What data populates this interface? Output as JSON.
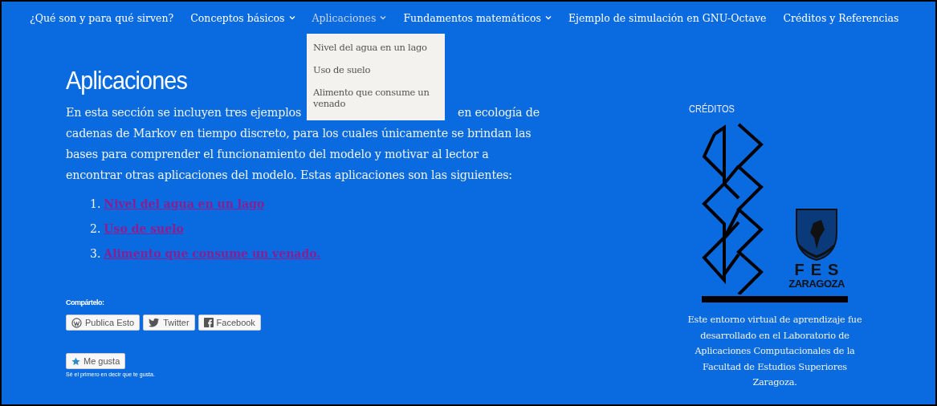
{
  "nav": {
    "items": [
      {
        "label": "¿Qué son y para qué sirven?",
        "has_submenu": false,
        "selected": false
      },
      {
        "label": "Conceptos básicos",
        "has_submenu": true,
        "selected": false
      },
      {
        "label": "Aplicaciones",
        "has_submenu": true,
        "selected": true
      },
      {
        "label": "Fundamentos matemáticos",
        "has_submenu": true,
        "selected": false
      },
      {
        "label": "Ejemplo de simulación en GNU-Octave",
        "has_submenu": false,
        "selected": false
      },
      {
        "label": "Créditos y Referencias",
        "has_submenu": false,
        "selected": false
      }
    ],
    "dropdown": [
      "Nivel del agua en un lago",
      "Uso de suelo",
      "Alimento que consume un venado"
    ]
  },
  "article": {
    "title": "Aplicaciones",
    "intro_before": "En esta sección se incluyen tres ejemplos",
    "intro_right": "en ecología de",
    "intro_after": "cadenas de Markov en tiempo discreto, para los cuales únicamente se brindan las bases para comprender el funcionamiento del modelo y motivar al lector a encontrar otras aplicaciones del modelo. Estas aplicaciones son las siguientes:",
    "list": [
      {
        "number": "1.",
        "link": "Nivel del agua en un lago"
      },
      {
        "number": "2.",
        "link": "Uso de suelo"
      },
      {
        "number": "3.",
        "link": "Alimento que consume un venado."
      }
    ],
    "share": {
      "label": "Compártelo:",
      "buttons": [
        {
          "label": "Publica Esto",
          "kind": "wordpress"
        },
        {
          "label": "Twitter",
          "kind": "bird"
        },
        {
          "label": "Facebook",
          "kind": "f"
        }
      ]
    },
    "like": {
      "button": "Me gusta",
      "note": "Sé el primero en decir que te gusta."
    }
  },
  "sidebar": {
    "heading": "CRÉDITOS",
    "logo_line1": "FES",
    "logo_line2": "ZARAGOZA",
    "text": "Este entorno virtual de aprendizaje fue desarrollado en el Laboratorio de Aplicaciones Computacionales de la Facultad de Estudios Superiores Zaragoza."
  }
}
